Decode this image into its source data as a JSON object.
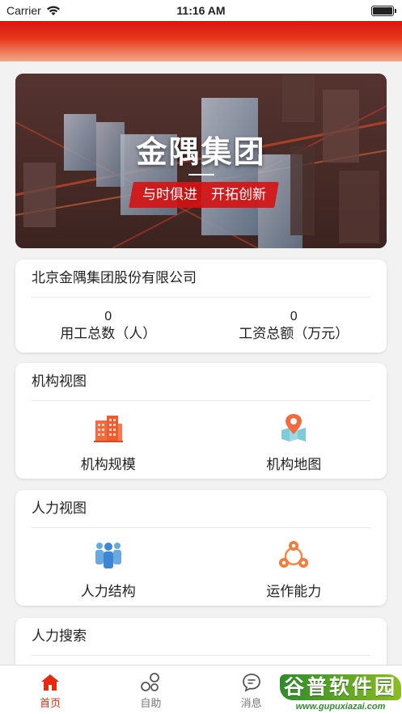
{
  "status_bar": {
    "carrier": "Carrier",
    "time": "11:16 AM"
  },
  "banner": {
    "title": "金隅集团",
    "slogan": "与时俱进　开拓创新"
  },
  "company": {
    "name": "北京金隅集团股份有限公司",
    "stats": [
      {
        "value": "0",
        "label": "用工总数（人）"
      },
      {
        "value": "0",
        "label": "工资总额（万元）"
      }
    ]
  },
  "org_view": {
    "title": "机构视图",
    "items": [
      {
        "label": "机构规模",
        "icon": "building-icon"
      },
      {
        "label": "机构地图",
        "icon": "map-pin-icon"
      }
    ]
  },
  "hr_view": {
    "title": "人力视图",
    "items": [
      {
        "label": "人力结构",
        "icon": "people-group-icon"
      },
      {
        "label": "运作能力",
        "icon": "network-icon"
      }
    ]
  },
  "hr_search": {
    "title": "人力搜索"
  },
  "tabs": [
    {
      "label": "首页",
      "icon": "home-icon",
      "active": true
    },
    {
      "label": "自助",
      "icon": "self-service-icon",
      "active": false
    },
    {
      "label": "消息",
      "icon": "message-icon",
      "active": false
    }
  ],
  "watermark": {
    "main": "谷普软件园",
    "sub": "www.gupuxiazai.com"
  },
  "colors": {
    "accent": "#e62a10",
    "header": "#d8150f",
    "slogan_bg": "#d61212"
  }
}
